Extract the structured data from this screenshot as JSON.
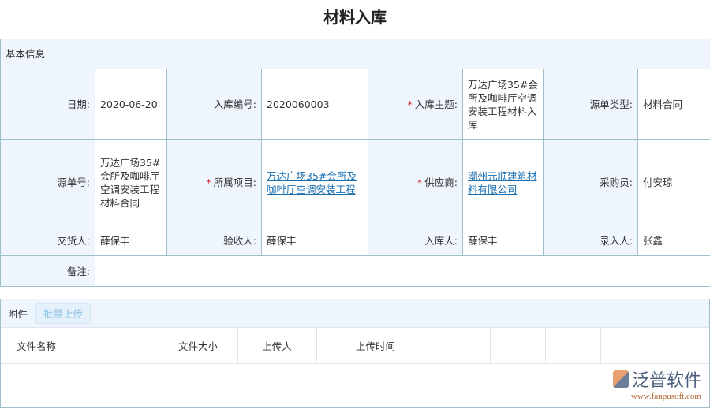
{
  "title": "材料入库",
  "section_basic": "基本信息",
  "fields": {
    "date_label": "日期:",
    "date": "2020-06-20",
    "no_label": "入库编号:",
    "no": "2020060003",
    "subject_label": "入库主题:",
    "subject": "万达广场35#会所及咖啡厅空调安装工程材料入库",
    "source_type_label": "源单类型:",
    "source_type": "材料合同",
    "source_no_label": "源单号:",
    "source_no": "万达广场35#会所及咖啡厅空调安装工程材料合同",
    "project_label": "所属项目:",
    "project": "万达广场35#会所及咖啡厅空调安装工程",
    "supplier_label": "供应商:",
    "supplier": "潮州元顺建筑材料有限公司",
    "buyer_label": "采购员:",
    "buyer": "付安琼",
    "deliverer_label": "交货人:",
    "deliverer": "薛保丰",
    "inspector_label": "验收人:",
    "inspector": "薛保丰",
    "receiver_label": "入库人:",
    "receiver": "薛保丰",
    "recorder_label": "录入人:",
    "recorder": "张鑫",
    "remark_label": "备注:",
    "remark": ""
  },
  "required_mark": "*",
  "attachments": {
    "label": "附件",
    "upload_button": "批量上传",
    "columns": [
      "文件名称",
      "文件大小",
      "上传人",
      "上传时间",
      "",
      "",
      "",
      "",
      ""
    ]
  },
  "logo": {
    "cn": "泛普软件",
    "en": "www.fanpusoft.com"
  }
}
